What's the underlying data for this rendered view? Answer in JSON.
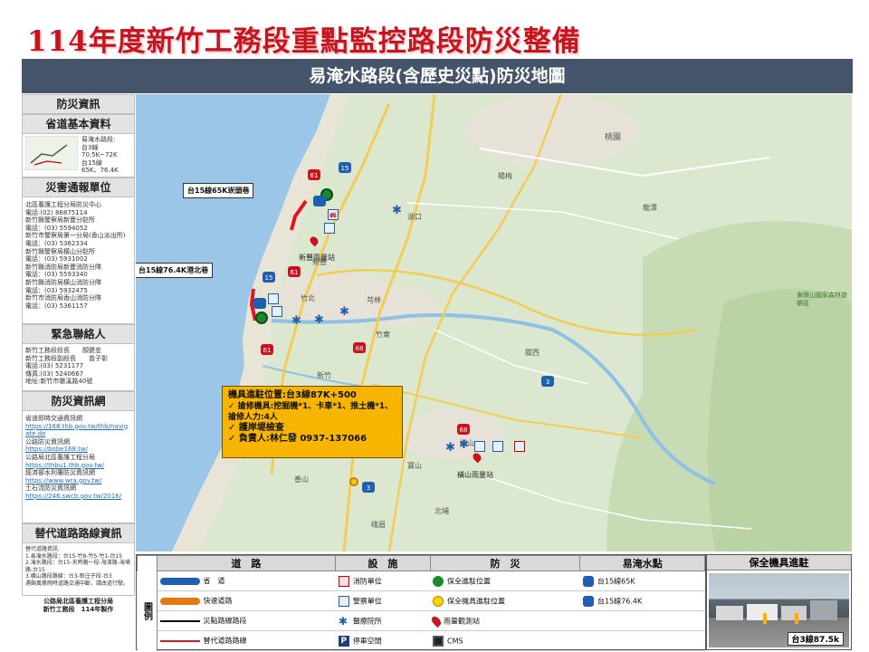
{
  "title": "114年度新竹工務段重點監控路段防災整備",
  "banner": "易淹水路段(含歷史災點)防災地圖",
  "sidebar": {
    "disaster_info_head": "防災資訊",
    "basic_head": "省道基本資料",
    "basic_lines": [
      "易淹水路段:",
      "台3線",
      "70.5K~72K",
      "台15線",
      "65K、76.4K"
    ],
    "notify_head": "災害通報單位",
    "notify_lines": [
      "北區養護工程分局防災中心",
      "電話:(02) 86875114",
      "新竹縣警察局新豐分駐所",
      "電話：(03) 5594052",
      "新竹市警察局第一分局(香山派出所)",
      "電話：(03) 5362334",
      "新竹縣警察局橫山分駐所",
      "電話：(03) 5931002",
      "新竹縣消防局新豐消防分隊",
      "電話：(03) 5593340",
      "新竹縣消防局橫山消防分隊",
      "電話：(03) 5932475",
      "新竹市消防局香山消防分隊",
      "電話：(03) 5361157"
    ],
    "contact_head": "緊急聯絡人",
    "contact_lines": [
      "新竹工務段段長　　顏健忠",
      "新竹工務段副段長　　曾子彰",
      "電話:(03) 5231177",
      "傳真:(03) 5240667",
      "地址:新竹市磐溪路40號"
    ],
    "net_head": "防災資訊網",
    "net_lines": [
      {
        "t": "省道即時交通資訊網",
        "link": false
      },
      {
        "t": "https://168.thb.gov.tw/thb/navigate.do",
        "link": true
      },
      {
        "t": "公路防災資訊網",
        "link": false
      },
      {
        "t": "https://bobe168.tw/",
        "link": true
      },
      {
        "t": "公路局北區養護工程分局",
        "link": false
      },
      {
        "t": "https://thbu1.thb.gov.tw/",
        "link": true
      },
      {
        "t": "經濟部水利署防災資訊網",
        "link": false
      },
      {
        "t": "https://www.wra.gov.tw/",
        "link": true
      },
      {
        "t": "土石流防災資訊網",
        "link": false
      },
      {
        "t": "https://246.swcb.gov.tw/2016/",
        "link": true
      }
    ],
    "alt_head": "替代道路路線資訊",
    "alt_lines": [
      "替代道路資訊:",
      "1.易淹水路段：台15-竹8-竹5-竹1-台15",
      "2.淹水路段：台15-天時路一段-海濱路-海埔路-台15",
      "3.橫山路段路線：台3-新庄子段-台3",
      "遇颱風豪雨時道路交通中斷，請改道行駛。"
    ],
    "footer": [
      "公路局北區養護工程分局",
      "新竹工務段　114年製作"
    ]
  },
  "map": {
    "callout_1": "台15線65K崁頭巷",
    "callout_2": "台15線76.4K港北巷",
    "station_1": "新豐雨量站",
    "station_2": "橫山雨量站",
    "infobox": {
      "line1": "機具進駐位置:台3線87K+500",
      "line2": "✓  搶修機具:挖掘機*1、卡車*1、推土機*1、搶修人力:4人",
      "line3": "✓  護岸堤檢查",
      "line4": "✓  負責人:林仁發 0937-137066"
    },
    "route_shields": [
      "61",
      "15",
      "61",
      "15",
      "68",
      "61",
      "3",
      "3",
      "68"
    ],
    "place_labels": [
      "新豐",
      "竹北",
      "竹東",
      "芎林",
      "橫山",
      "關西",
      "新竹",
      "香山",
      "寶山",
      "北埔",
      "峨眉",
      "桃園",
      "東眼山國家森林遊樂區",
      "龍潭",
      "湖口",
      "楊梅"
    ]
  },
  "legend": {
    "side_label": "圖例",
    "headers": [
      "道　路",
      "設　施",
      "防　災",
      "易淹水點",
      "保全機具進駐"
    ],
    "rows": [
      {
        "road": "省　道",
        "facility": "消防單位",
        "disaster": "保全進駐位置",
        "flood": "台15線65K"
      },
      {
        "road": "快速道路",
        "facility": "警察單位",
        "disaster": "保全機具進駐位置",
        "flood": "台15線76.4K"
      },
      {
        "road": "災點路線路段",
        "facility": "醫療院所",
        "disaster": "雨量觀測站",
        "flood": ""
      },
      {
        "road": "替代道路路線",
        "facility": "停車空間",
        "disaster": "CMS",
        "flood": ""
      }
    ],
    "photo_caption": "台3線87.5k"
  }
}
